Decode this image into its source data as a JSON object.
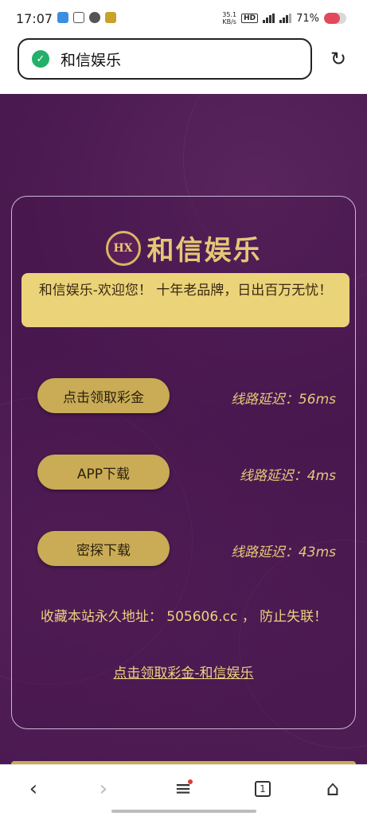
{
  "status_bar": {
    "time": "17:07",
    "net_speed_value": "35.1",
    "net_speed_unit": "KB/s",
    "hd": "HD",
    "battery": "71%",
    "battery_level": 0.71
  },
  "address_bar": {
    "title": "和信娱乐"
  },
  "card": {
    "logo_text": "和信娱乐",
    "notice": "和信娱乐-欢迎您！ 十年老品牌，日出百万无忧！",
    "routes": [
      {
        "label": "点击领取彩金",
        "latency": "线路延迟：56ms"
      },
      {
        "label": "APP下载",
        "latency": "线路延迟：4ms"
      },
      {
        "label": "密探下载",
        "latency": "线路延迟：43ms"
      }
    ],
    "permanent_address": "收藏本站永久地址： 505606.cc ， 防止失联！",
    "bottom_link": "点击领取彩金-和信娱乐"
  },
  "nav": {
    "tab_count": "1"
  },
  "colors": {
    "background_purple": "#4a1950",
    "gold": "#c9ac55",
    "notice_yellow": "#ebd37a",
    "secure_green": "#23b06a"
  }
}
